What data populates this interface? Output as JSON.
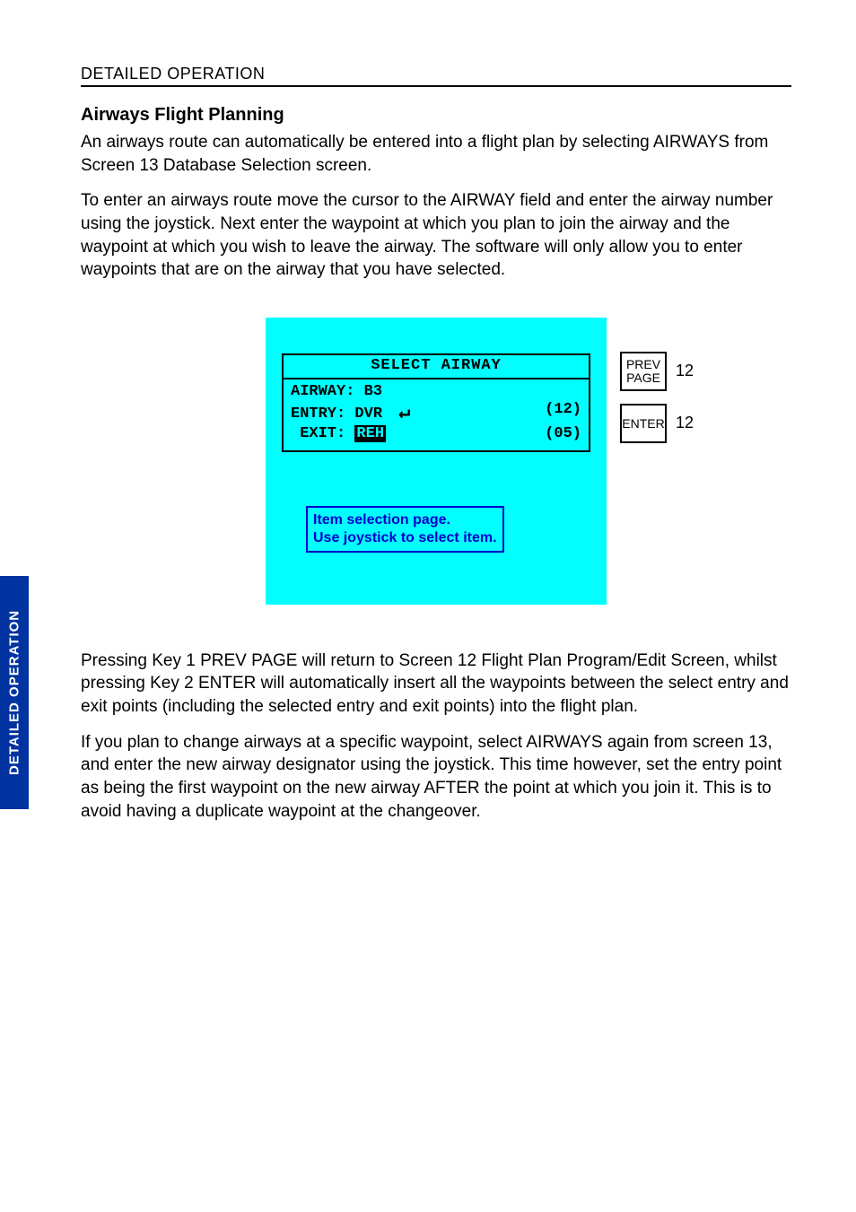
{
  "header": "DETAILED OPERATION",
  "title": "Airways Flight Planning",
  "para1": "An airways route can automatically be entered into a flight plan by selecting AIRWAYS from Screen 13 Database Selection screen.",
  "para2": "To enter an airways route move the cursor to the AIRWAY field and enter the airway number using the joystick. Next enter the waypoint at which you plan to join the airway and the waypoint at which you wish to leave the airway. The software will only allow you to enter waypoints that are on the airway that you have selected.",
  "screen": {
    "title": "SELECT AIRWAY",
    "row1_left": "AIRWAY: B3",
    "row2_left": "ENTRY: DVR",
    "row2_right": "(12)",
    "row3_left_label": " EXIT: ",
    "row3_left_value": "REH",
    "row3_right": "(05)",
    "arrow": "↵",
    "hint_line1": "Item selection page.",
    "hint_line2": "Use joystick to select item."
  },
  "keys": {
    "k1_line1": "PREV",
    "k1_line2": "PAGE",
    "k1_num": "12",
    "k2_line1": "ENTER",
    "k2_num": "12"
  },
  "para3": "Pressing Key 1 PREV PAGE will return to Screen 12 Flight Plan Program/Edit Screen, whilst pressing Key 2 ENTER will automatically insert all the waypoints between the select entry and exit points (including the selected entry and exit points) into the flight plan.",
  "para4": "If you plan to change airways at a specific waypoint, select AIRWAYS again from screen 13, and enter the new airway designator using the joystick. This time however, set the entry point as being the first waypoint on the new airway AFTER the point at which you join it. This is to avoid having a duplicate waypoint at the changeover.",
  "sidetab": "DETAILED OPERATION"
}
